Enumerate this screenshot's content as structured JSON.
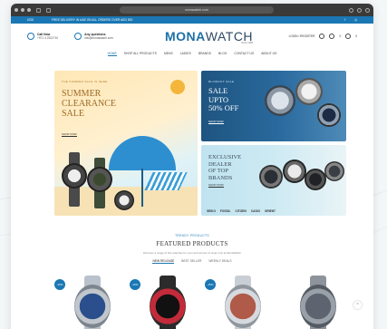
{
  "browser": {
    "url": "monawatch.com"
  },
  "topbar": {
    "currency": "USD",
    "promo": "FREE DELIVERY IN UAE ON ALL ORDERS OVER AED 500"
  },
  "header": {
    "phone_label": "Call Now",
    "phone_value": "+971 4 2202710",
    "email_label": "Any questions",
    "email_value": "info@monawatch.com",
    "logo_main": "MONA",
    "logo_rest": "WATCH",
    "logo_tag": "Since 1985",
    "login_label": "LOGIN / REGISTER",
    "wishlist_count": "0",
    "cart_count": "0"
  },
  "menu": [
    "HOME",
    "SHOP ALL PRODUCTS",
    "MENS",
    "LADIES",
    "BRANDS",
    "BLOG",
    "CONTACT US",
    "ABOUT US"
  ],
  "banner_left": {
    "small": "THE SUMMER SALE IS HERE",
    "title_line1": "SUMMER",
    "title_line2": "CLEARANCE",
    "title_line3": "SALE",
    "cta": "SHOP NOW"
  },
  "banner_right_top": {
    "small": "BLOWOUT SALE",
    "line1": "SALE",
    "line2": "UPTO",
    "line3": "50% OFF",
    "cta": "SHOP NOW"
  },
  "banner_right_bottom": {
    "line1": "EXCLUSIVE",
    "line2": "DEALER",
    "line3": "OF TOP",
    "line4": "BRANDS",
    "cta": "SHOP NOW",
    "brands": [
      "SEIKO",
      "FOSSIL",
      "CITIZEN",
      "CASIO",
      "ORIENT"
    ]
  },
  "featured": {
    "pre": "TRENDY PRODUCTS",
    "title": "FEATURED PRODUCTS",
    "desc": "Discover a range of fine watches for men and women to wear only at MonaWatch",
    "tabs": [
      "NEW RELEASE",
      "BEST SELLER",
      "WEEKLY DEALS"
    ]
  },
  "products": [
    {
      "badge": "-15%",
      "dial": "#2a4f8c",
      "strap": "#b9c2cc"
    },
    {
      "badge": "-15%",
      "dial": "#c42b3a",
      "strap": "#2b2b2b"
    },
    {
      "badge": "-15%",
      "dial": "#b05a4a",
      "strap": "#c9ced4"
    },
    {
      "badge": "",
      "dial": "#5d6470",
      "strap": "#8e949c"
    }
  ],
  "scroll_top": "⌃"
}
